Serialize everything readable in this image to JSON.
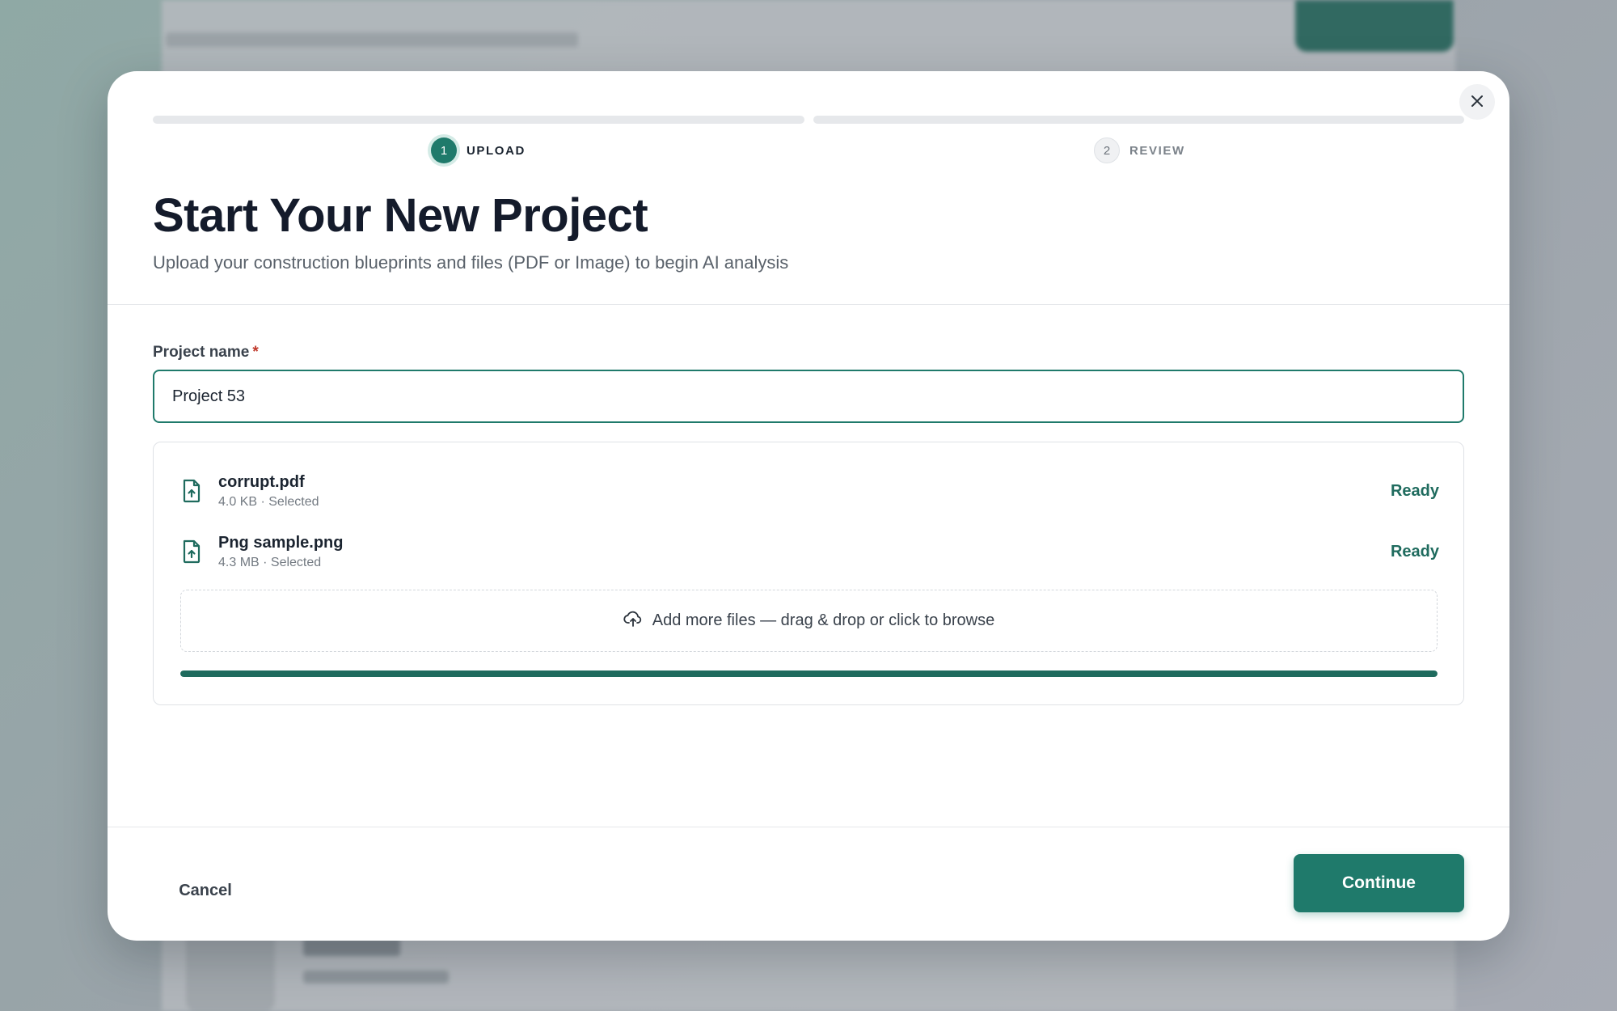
{
  "colors": {
    "accent": "#1f7a6b",
    "accent_dark": "#1f6b5e",
    "required": "#c0392b"
  },
  "stepper": {
    "steps": [
      {
        "number": "1",
        "label": "UPLOAD",
        "state": "active"
      },
      {
        "number": "2",
        "label": "REVIEW",
        "state": "inactive"
      }
    ]
  },
  "header": {
    "title": "Start Your New Project",
    "subtitle": "Upload your construction blueprints and files (PDF or Image) to begin AI analysis"
  },
  "form": {
    "project_name_label": "Project name",
    "required_marker": "*",
    "project_name_value": "Project 53"
  },
  "files": [
    {
      "name": "corrupt.pdf",
      "meta": "4.0 KB · Selected",
      "status": "Ready",
      "icon": "file-upload-icon"
    },
    {
      "name": "Png sample.png",
      "meta": "4.3 MB · Selected",
      "status": "Ready",
      "icon": "file-upload-icon"
    }
  ],
  "dropzone": {
    "icon": "cloud-upload-icon",
    "text": "Add more files — drag & drop or click to browse"
  },
  "upload_progress": 1.0,
  "footer": {
    "cancel_label": "Cancel",
    "continue_label": "Continue"
  },
  "close_icon": "close-icon"
}
